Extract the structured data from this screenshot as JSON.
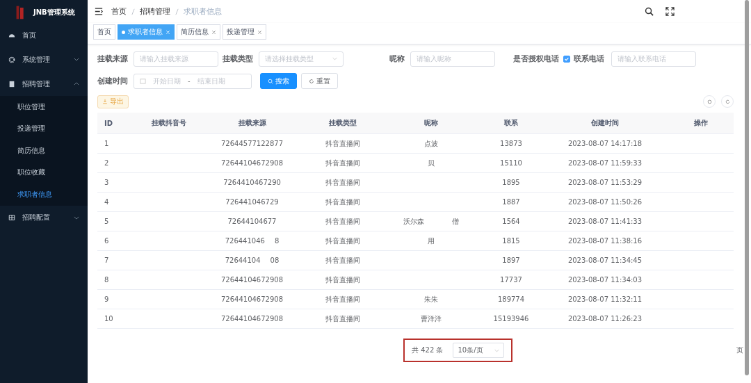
{
  "app": {
    "title": "JNB管理系统"
  },
  "sidebar": {
    "items": [
      {
        "label": "首页",
        "selected": false
      },
      {
        "label": "系统管理",
        "selected": false,
        "expanded": false
      },
      {
        "label": "招聘管理",
        "selected": false,
        "expanded": true,
        "children": [
          {
            "label": "职位管理",
            "selected": false
          },
          {
            "label": "投递管理",
            "selected": false
          },
          {
            "label": "简历信息",
            "selected": false
          },
          {
            "label": "职位收藏",
            "selected": false
          },
          {
            "label": "求职者信息",
            "selected": true
          }
        ]
      },
      {
        "label": "招聘配置",
        "selected": false,
        "expanded": false
      }
    ]
  },
  "breadcrumb": [
    "首页",
    "招聘管理",
    "求职者信息"
  ],
  "tabs": [
    {
      "label": "首页",
      "selected": false,
      "closable": false
    },
    {
      "label": "求职者信息",
      "selected": true,
      "closable": true
    },
    {
      "label": "简历信息",
      "selected": false,
      "closable": true
    },
    {
      "label": "投递管理",
      "selected": false,
      "closable": true
    }
  ],
  "filters": {
    "source": {
      "label": "挂载来源",
      "placeholder": "请输入挂载来源"
    },
    "type": {
      "label": "挂载类型",
      "placeholder": "请选择挂载类型"
    },
    "nickname": {
      "label": "昵称",
      "placeholder": "请输入昵称"
    },
    "authorized": {
      "label": "是否授权电话",
      "checked": true,
      "option": "联系电话"
    },
    "phone": {
      "placeholder": "请输入联系电话"
    },
    "created": {
      "label": "创建时间",
      "start_placeholder": "开始日期",
      "separator": "-",
      "end_placeholder": "结束日期"
    },
    "search_button": "搜索",
    "reset_button": "重置"
  },
  "export_button": "导出",
  "table": {
    "columns": [
      "ID",
      "挂载抖音号",
      "挂载来源",
      "挂载类型",
      "昵称",
      "联系",
      "创建时间",
      "操作"
    ],
    "rows": [
      {
        "id": "1",
        "source": "72644577122877",
        "type": "抖音直播间",
        "nickname": "点波",
        "phone": "13873",
        "created": "2023-08-07 14:17:18"
      },
      {
        "id": "2",
        "source": "72644104672908",
        "type": "抖音直播间",
        "nickname": "贝",
        "phone": "15110",
        "created": "2023-08-07 11:59:33"
      },
      {
        "id": "3",
        "source": "7264410467290",
        "type": "抖音直播间",
        "phone": "1895",
        "created": "2023-08-07 11:53:29"
      },
      {
        "id": "4",
        "source": "726441046729",
        "type": "抖音直播间",
        "phone": "1887",
        "created": "2023-08-07 11:50:26"
      },
      {
        "id": "5",
        "source": "72644104677",
        "type": "抖音直播间",
        "nickname": "沃尔森",
        "note": "僧",
        "phone": "1564",
        "created": "2023-08-07 11:41:33"
      },
      {
        "id": "6",
        "source": "726441046",
        "source_tail": "8",
        "type": "抖音直播间",
        "nickname": "用",
        "phone": "1815",
        "created": "2023-08-07 11:38:16"
      },
      {
        "id": "7",
        "source": "72644104",
        "source_tail": "08",
        "type": "抖音直播间",
        "phone": "1897",
        "created": "2023-08-07 11:34:45"
      },
      {
        "id": "8",
        "source": "72644104672908",
        "type": "抖音直播间",
        "phone": "17737",
        "created": "2023-08-07 11:34:03"
      },
      {
        "id": "9",
        "source": "72644104672908",
        "type": "抖音直播间",
        "nickname": "朱朱",
        "phone": "189774",
        "created": "2023-08-07 11:32:11"
      },
      {
        "id": "10",
        "source": "72644104672908",
        "type": "抖音直播间",
        "nickname": "曹洋洋",
        "phone": "15193946",
        "created": "2023-08-07 11:26:23"
      }
    ]
  },
  "pagination": {
    "total": "共 422 条",
    "page_size": "10条/页",
    "highlighted": true,
    "tail": "页"
  }
}
